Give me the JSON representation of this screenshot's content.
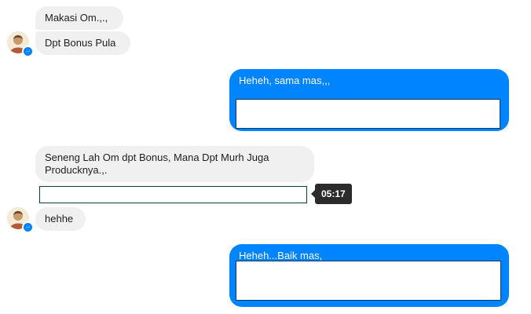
{
  "messages": [
    {
      "side": "in",
      "text": "Makasi Om.,.,"
    },
    {
      "side": "in",
      "text": "Dpt Bonus Pula"
    },
    {
      "side": "out",
      "text": "Heheh, sama mas,,,"
    },
    {
      "side": "in",
      "text": "Seneng Lah Om dpt Bonus, Mana Dpt Murh Juga Producknya.,."
    },
    {
      "side": "in",
      "text": "hehhe"
    },
    {
      "side": "out",
      "text": "Heheh...Baik mas,"
    }
  ],
  "tooltip": {
    "time": "05:17"
  },
  "colors": {
    "accent": "#0084ff",
    "incoming_bg": "#f1f0f0"
  },
  "icons": {
    "avatar": "user-avatar",
    "badge": "messenger-badge-icon"
  }
}
